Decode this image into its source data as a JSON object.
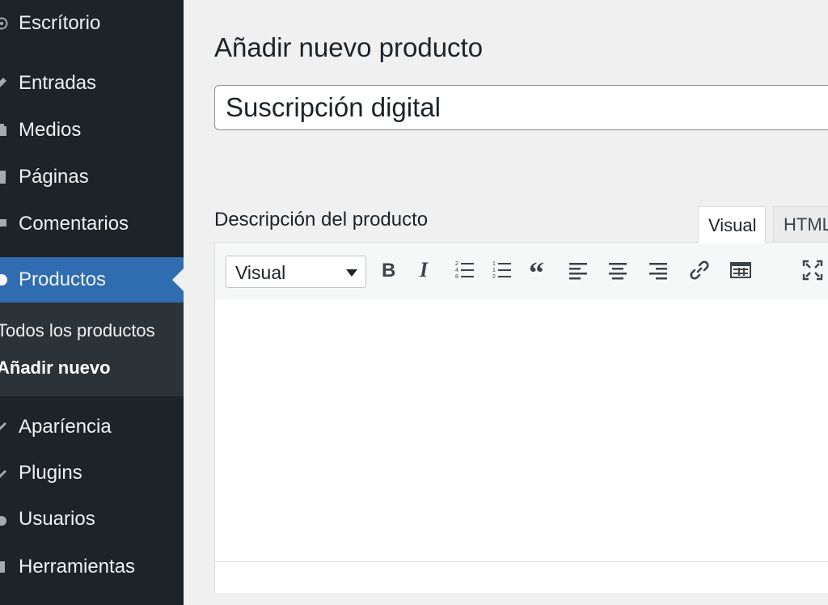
{
  "sidebar": {
    "items": [
      {
        "label": "Escrítorio",
        "icon": "dashboard-icon"
      },
      {
        "label": "Entradas",
        "icon": "pushpin-icon"
      },
      {
        "label": "Medios",
        "icon": "media-icon"
      },
      {
        "label": "Páginas",
        "icon": "page-icon"
      },
      {
        "label": "Comentarios",
        "icon": "comment-icon"
      },
      {
        "label": "Productos",
        "icon": "product-icon",
        "active": true
      },
      {
        "label": "Aparíencia",
        "icon": "brush-icon"
      },
      {
        "label": "Plugins",
        "icon": "plugin-icon"
      },
      {
        "label": "Usuarios",
        "icon": "user-icon"
      },
      {
        "label": "Herramientas",
        "icon": "tools-icon"
      }
    ],
    "submenu": [
      {
        "label": "Todos los productos"
      },
      {
        "label": "Añadir nuevo",
        "current": true
      }
    ]
  },
  "main": {
    "title": "Añadir nuevo producto",
    "title_input_value": "Suscripción digital",
    "description_label": "Descripción del producto",
    "tabs": [
      {
        "label": "Visual",
        "active": true
      },
      {
        "label": "HTML"
      }
    ],
    "toolbar": {
      "format_select_value": "Visual",
      "buttons": [
        "bold-icon",
        "italic-icon",
        "numbered-list-icon",
        "ordered-list-icon",
        "blockquote-icon",
        "align-left-icon",
        "align-center-icon",
        "align-right-icon",
        "link-icon",
        "toolbar-toggle-icon",
        "fullscreen-icon"
      ]
    },
    "editor_content": ""
  },
  "colors": {
    "sidebar_bg": "#1d2327",
    "active_bg": "#2f6db0",
    "submenu_bg": "#2c3338",
    "page_bg": "#f0f0f1"
  }
}
